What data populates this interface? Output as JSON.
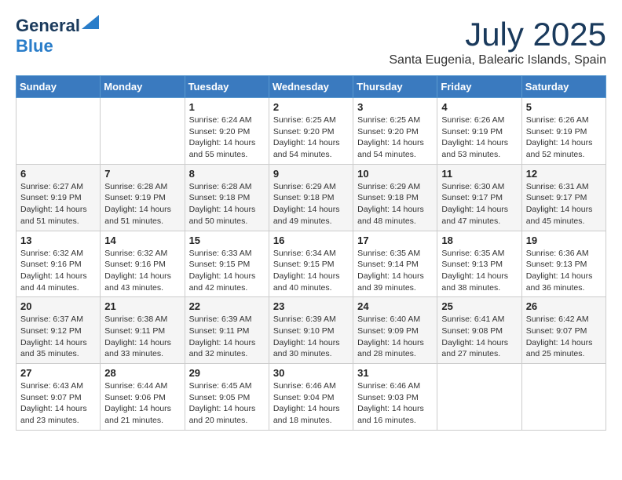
{
  "header": {
    "logo_general": "General",
    "logo_blue": "Blue",
    "month_title": "July 2025",
    "subtitle": "Santa Eugenia, Balearic Islands, Spain"
  },
  "weekdays": [
    "Sunday",
    "Monday",
    "Tuesday",
    "Wednesday",
    "Thursday",
    "Friday",
    "Saturday"
  ],
  "weeks": [
    [
      {
        "day": "",
        "info": ""
      },
      {
        "day": "",
        "info": ""
      },
      {
        "day": "1",
        "info": "Sunrise: 6:24 AM\nSunset: 9:20 PM\nDaylight: 14 hours and 55 minutes."
      },
      {
        "day": "2",
        "info": "Sunrise: 6:25 AM\nSunset: 9:20 PM\nDaylight: 14 hours and 54 minutes."
      },
      {
        "day": "3",
        "info": "Sunrise: 6:25 AM\nSunset: 9:20 PM\nDaylight: 14 hours and 54 minutes."
      },
      {
        "day": "4",
        "info": "Sunrise: 6:26 AM\nSunset: 9:19 PM\nDaylight: 14 hours and 53 minutes."
      },
      {
        "day": "5",
        "info": "Sunrise: 6:26 AM\nSunset: 9:19 PM\nDaylight: 14 hours and 52 minutes."
      }
    ],
    [
      {
        "day": "6",
        "info": "Sunrise: 6:27 AM\nSunset: 9:19 PM\nDaylight: 14 hours and 51 minutes."
      },
      {
        "day": "7",
        "info": "Sunrise: 6:28 AM\nSunset: 9:19 PM\nDaylight: 14 hours and 51 minutes."
      },
      {
        "day": "8",
        "info": "Sunrise: 6:28 AM\nSunset: 9:18 PM\nDaylight: 14 hours and 50 minutes."
      },
      {
        "day": "9",
        "info": "Sunrise: 6:29 AM\nSunset: 9:18 PM\nDaylight: 14 hours and 49 minutes."
      },
      {
        "day": "10",
        "info": "Sunrise: 6:29 AM\nSunset: 9:18 PM\nDaylight: 14 hours and 48 minutes."
      },
      {
        "day": "11",
        "info": "Sunrise: 6:30 AM\nSunset: 9:17 PM\nDaylight: 14 hours and 47 minutes."
      },
      {
        "day": "12",
        "info": "Sunrise: 6:31 AM\nSunset: 9:17 PM\nDaylight: 14 hours and 45 minutes."
      }
    ],
    [
      {
        "day": "13",
        "info": "Sunrise: 6:32 AM\nSunset: 9:16 PM\nDaylight: 14 hours and 44 minutes."
      },
      {
        "day": "14",
        "info": "Sunrise: 6:32 AM\nSunset: 9:16 PM\nDaylight: 14 hours and 43 minutes."
      },
      {
        "day": "15",
        "info": "Sunrise: 6:33 AM\nSunset: 9:15 PM\nDaylight: 14 hours and 42 minutes."
      },
      {
        "day": "16",
        "info": "Sunrise: 6:34 AM\nSunset: 9:15 PM\nDaylight: 14 hours and 40 minutes."
      },
      {
        "day": "17",
        "info": "Sunrise: 6:35 AM\nSunset: 9:14 PM\nDaylight: 14 hours and 39 minutes."
      },
      {
        "day": "18",
        "info": "Sunrise: 6:35 AM\nSunset: 9:13 PM\nDaylight: 14 hours and 38 minutes."
      },
      {
        "day": "19",
        "info": "Sunrise: 6:36 AM\nSunset: 9:13 PM\nDaylight: 14 hours and 36 minutes."
      }
    ],
    [
      {
        "day": "20",
        "info": "Sunrise: 6:37 AM\nSunset: 9:12 PM\nDaylight: 14 hours and 35 minutes."
      },
      {
        "day": "21",
        "info": "Sunrise: 6:38 AM\nSunset: 9:11 PM\nDaylight: 14 hours and 33 minutes."
      },
      {
        "day": "22",
        "info": "Sunrise: 6:39 AM\nSunset: 9:11 PM\nDaylight: 14 hours and 32 minutes."
      },
      {
        "day": "23",
        "info": "Sunrise: 6:39 AM\nSunset: 9:10 PM\nDaylight: 14 hours and 30 minutes."
      },
      {
        "day": "24",
        "info": "Sunrise: 6:40 AM\nSunset: 9:09 PM\nDaylight: 14 hours and 28 minutes."
      },
      {
        "day": "25",
        "info": "Sunrise: 6:41 AM\nSunset: 9:08 PM\nDaylight: 14 hours and 27 minutes."
      },
      {
        "day": "26",
        "info": "Sunrise: 6:42 AM\nSunset: 9:07 PM\nDaylight: 14 hours and 25 minutes."
      }
    ],
    [
      {
        "day": "27",
        "info": "Sunrise: 6:43 AM\nSunset: 9:07 PM\nDaylight: 14 hours and 23 minutes."
      },
      {
        "day": "28",
        "info": "Sunrise: 6:44 AM\nSunset: 9:06 PM\nDaylight: 14 hours and 21 minutes."
      },
      {
        "day": "29",
        "info": "Sunrise: 6:45 AM\nSunset: 9:05 PM\nDaylight: 14 hours and 20 minutes."
      },
      {
        "day": "30",
        "info": "Sunrise: 6:46 AM\nSunset: 9:04 PM\nDaylight: 14 hours and 18 minutes."
      },
      {
        "day": "31",
        "info": "Sunrise: 6:46 AM\nSunset: 9:03 PM\nDaylight: 14 hours and 16 minutes."
      },
      {
        "day": "",
        "info": ""
      },
      {
        "day": "",
        "info": ""
      }
    ]
  ]
}
